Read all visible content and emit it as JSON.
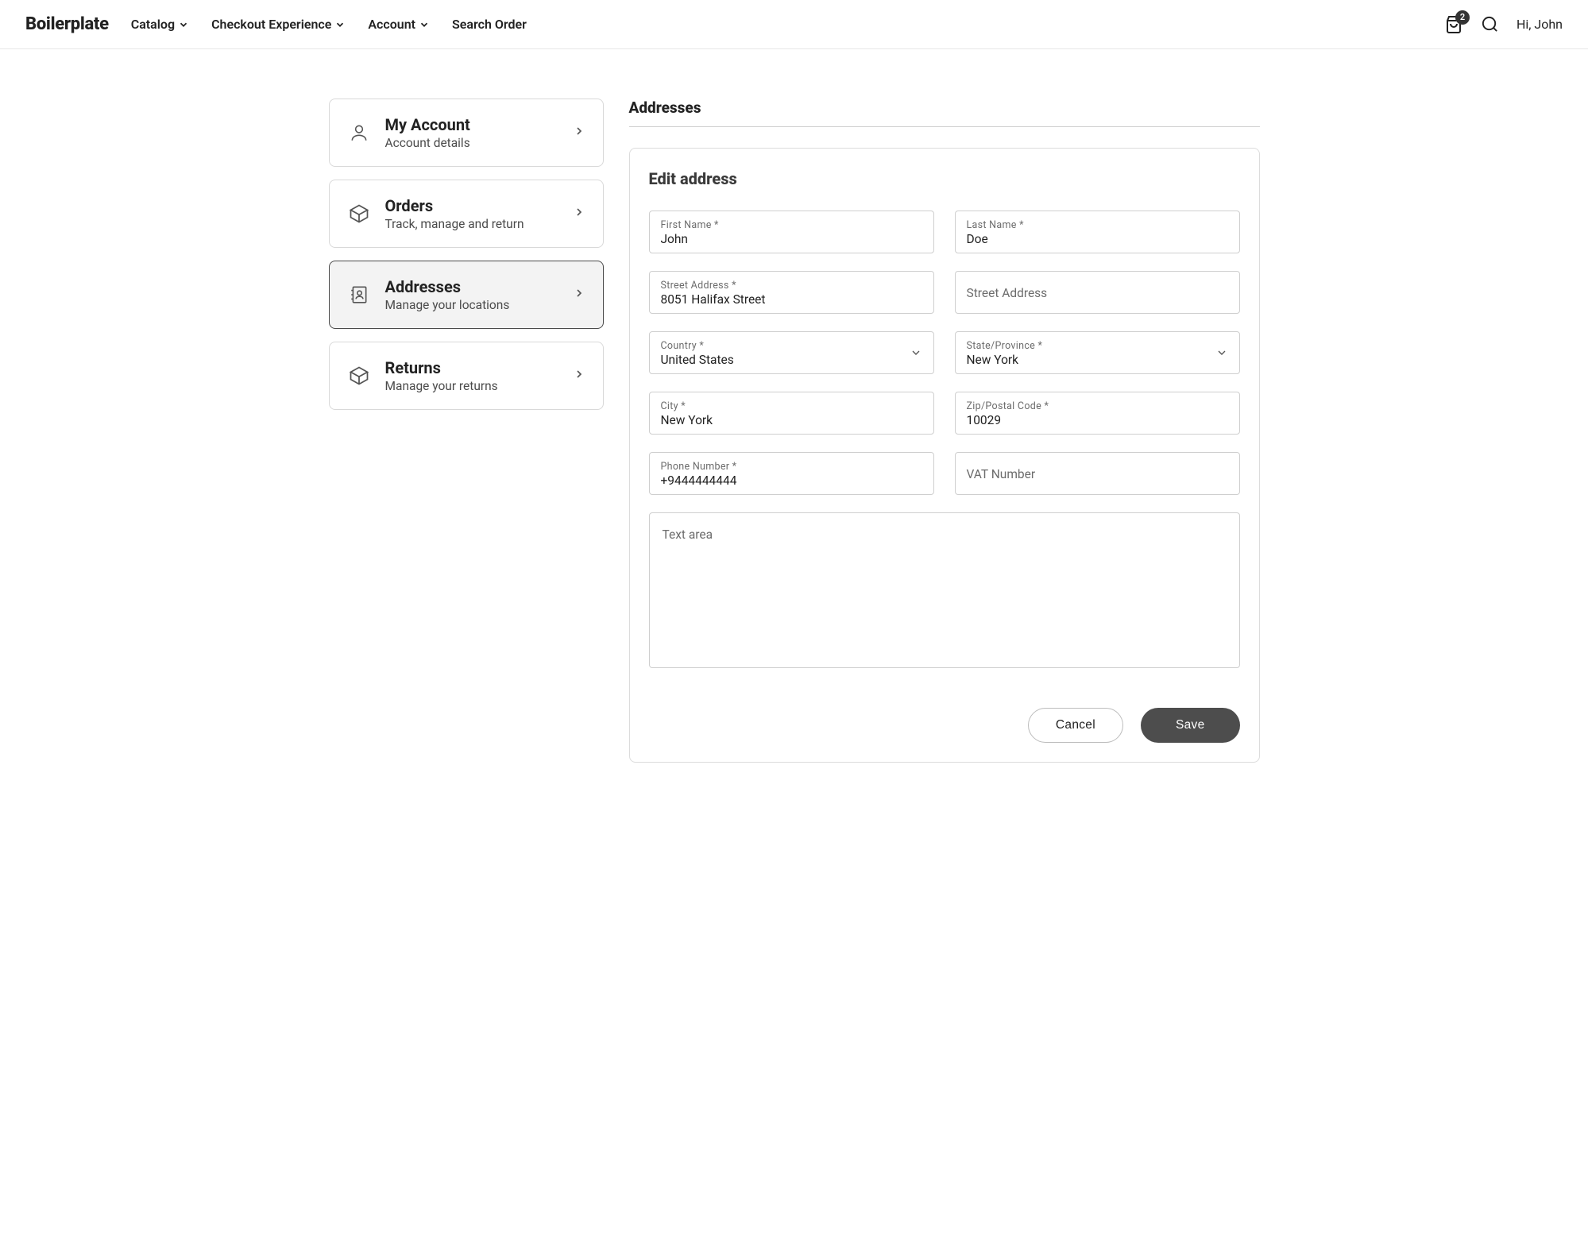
{
  "header": {
    "logo": "Boilerplate",
    "nav": {
      "catalog": "Catalog",
      "checkout": "Checkout Experience",
      "account": "Account",
      "search_order": "Search Order"
    },
    "cart_count": "2",
    "greeting": "Hi, John"
  },
  "sidebar": {
    "my_account": {
      "title": "My Account",
      "sub": "Account details"
    },
    "orders": {
      "title": "Orders",
      "sub": "Track, manage and return"
    },
    "addresses": {
      "title": "Addresses",
      "sub": "Manage your locations"
    },
    "returns": {
      "title": "Returns",
      "sub": "Manage your returns"
    }
  },
  "page": {
    "title": "Addresses",
    "card_title": "Edit address"
  },
  "form": {
    "first_name": {
      "label": "First Name *",
      "value": "John"
    },
    "last_name": {
      "label": "Last Name *",
      "value": "Doe"
    },
    "street1": {
      "label": "Street Address *",
      "value": "8051 Halifax Street"
    },
    "street2": {
      "placeholder": "Street Address"
    },
    "country": {
      "label": "Country *",
      "value": "United States"
    },
    "state": {
      "label": "State/Province *",
      "value": "New York"
    },
    "city": {
      "label": "City *",
      "value": "New York"
    },
    "zip": {
      "label": "Zip/Postal Code *",
      "value": "10029"
    },
    "phone": {
      "label": "Phone Number *",
      "value": "+9444444444"
    },
    "vat": {
      "placeholder": "VAT Number"
    },
    "notes": {
      "placeholder": "Text area"
    }
  },
  "actions": {
    "cancel": "Cancel",
    "save": "Save"
  }
}
